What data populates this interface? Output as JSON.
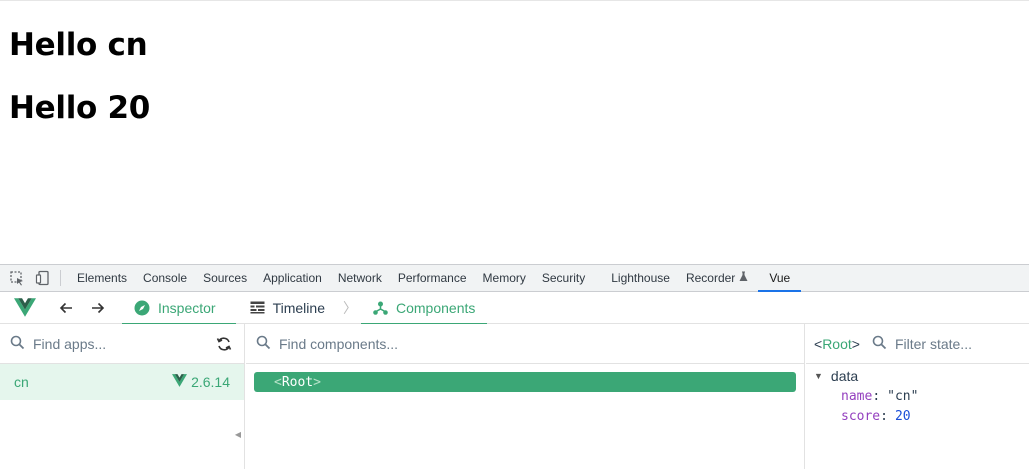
{
  "page": {
    "heading_1": "Hello cn",
    "heading_2": "Hello 20"
  },
  "devtools": {
    "tabs": [
      {
        "label": "Elements"
      },
      {
        "label": "Console"
      },
      {
        "label": "Sources"
      },
      {
        "label": "Application"
      },
      {
        "label": "Network"
      },
      {
        "label": "Performance"
      },
      {
        "label": "Memory"
      },
      {
        "label": "Security"
      },
      {
        "label": "Lighthouse"
      },
      {
        "label": "Recorder"
      },
      {
        "label": "Vue"
      }
    ],
    "active_tab": "Vue",
    "active_color": "#1a73e8"
  },
  "vue_toolbar": {
    "inspector_label": "Inspector",
    "timeline_label": "Timeline",
    "components_label": "Components",
    "accent_color": "#3ba776"
  },
  "apps_panel": {
    "search_placeholder": "Find apps...",
    "apps": [
      {
        "name": "cn",
        "version": "2.6.14"
      }
    ]
  },
  "components_panel": {
    "search_placeholder": "Find components...",
    "root_open": "<",
    "root_name": "Root",
    "root_close": ">"
  },
  "state_panel": {
    "selected_open": "<",
    "selected_name": "Root",
    "selected_close": ">",
    "filter_placeholder": "Filter state...",
    "section_title": "data",
    "props": [
      {
        "key": "name",
        "value": "\"cn\""
      },
      {
        "key": "score",
        "value": "20"
      }
    ]
  }
}
